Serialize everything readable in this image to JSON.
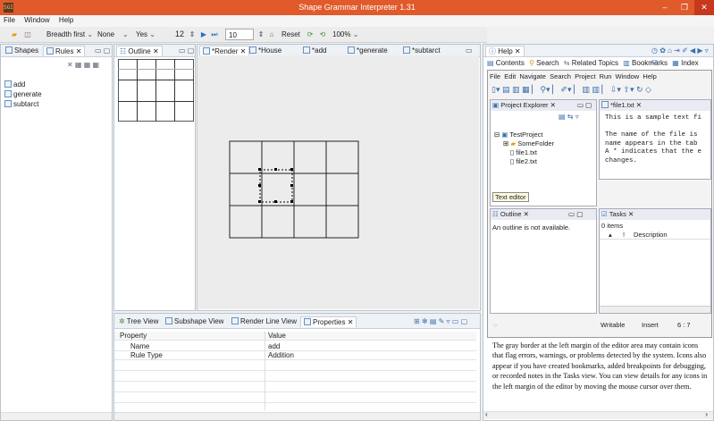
{
  "window": {
    "title": "Shape Grammar Interpreter 1.31",
    "app_icon": "SGI",
    "minimize": "–",
    "maximize": "❐",
    "close": "✕"
  },
  "menu": [
    "File",
    "Window",
    "Help"
  ],
  "toolbar": {
    "search_mode": "Breadth first",
    "search_sep": "None",
    "option": "Yes",
    "count": "12",
    "steps": "10",
    "reset": "Reset",
    "zoom": "100%"
  },
  "left_pane": {
    "tabs": [
      "Shapes",
      "Rules"
    ],
    "rules": [
      "add",
      "generate",
      "subtarct"
    ]
  },
  "outline_pane": {
    "tab": "Outline"
  },
  "editor_tabs": [
    "*Render",
    "*House",
    "*add",
    "*generate",
    "*subtarct"
  ],
  "bottom_pane": {
    "tabs": [
      "Tree View",
      "Subshape View",
      "Render Line View",
      "Properties"
    ],
    "columns": [
      "Property",
      "Value"
    ],
    "rows": [
      {
        "property": "Name",
        "value": "add"
      },
      {
        "property": "Rule Type",
        "value": "Addition"
      }
    ]
  },
  "help_pane": {
    "tab": "Help",
    "nav": [
      "Contents",
      "Search",
      "Related Topics",
      "Bookmarks",
      "Index"
    ],
    "inner_menu": [
      "File",
      "Edit",
      "Navigate",
      "Search",
      "Project",
      "Run",
      "Window",
      "Help"
    ],
    "project_explorer": {
      "tab": "Project Explorer",
      "tree": [
        "TestProject",
        "SomeFolder",
        "file1.txt",
        "file2.txt"
      ],
      "tooltip": "Text editor"
    },
    "editor": {
      "tab": "*file1.txt",
      "lines": [
        "This is a sample text fi",
        "",
        "The name of the file is",
        "name appears in the tab",
        "A * indicates that the e",
        "changes."
      ]
    },
    "outline": {
      "tab": "Outline",
      "message": "An outline is not available."
    },
    "tasks": {
      "tab": "Tasks",
      "count": "0 items",
      "columns": [
        "!",
        "Description"
      ]
    },
    "status": {
      "writable": "Writable",
      "insert": "Insert",
      "position": "6 : 7"
    },
    "description": "The gray border at the left margin of the editor area may contain icons that flag errors, warnings, or problems detected by the system. Icons also appear if you have created bookmarks, added breakpoints for debugging, or recorded notes in the Tasks view. You can view details for any icons in the left margin of the editor by moving the mouse cursor over them."
  },
  "colors": {
    "titlebar": "#e05a2b",
    "selection": "#eaf2fb"
  }
}
